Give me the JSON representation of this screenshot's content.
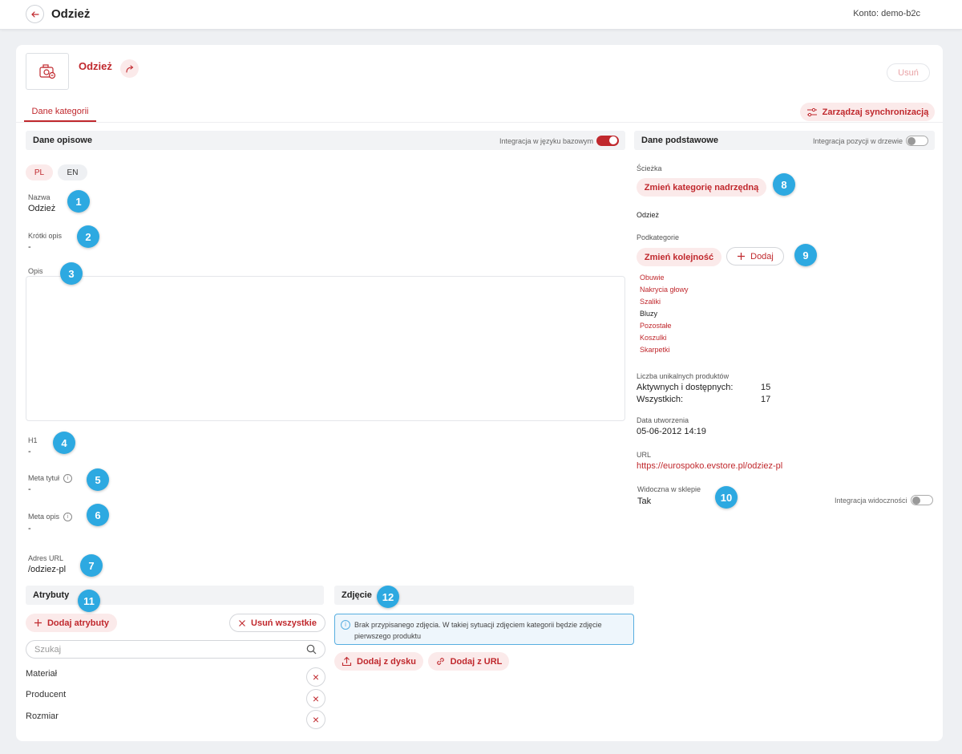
{
  "topbar": {
    "title": "Odzież",
    "account": "Konto: demo-b2c"
  },
  "header": {
    "title": "Odzież",
    "delete_label": "Usuń"
  },
  "tabs": [
    {
      "label": "Dane kategorii"
    }
  ],
  "sync_button": {
    "label": "Zarządzaj synchronizacją"
  },
  "descriptive": {
    "title": "Dane opisowe",
    "integration_label": "Integracja w języku bazowym",
    "languages": [
      "PL",
      "EN"
    ],
    "fields": {
      "name": {
        "label": "Nazwa",
        "value": "Odzież"
      },
      "short_desc": {
        "label": "Krótki opis",
        "value": "-"
      },
      "desc": {
        "label": "Opis"
      },
      "h1": {
        "label": "H1",
        "value": "-"
      },
      "meta_title": {
        "label": "Meta tytuł",
        "value": "-"
      },
      "meta_desc": {
        "label": "Meta opis",
        "value": "-"
      },
      "url": {
        "label": "Adres URL",
        "value": "/odziez-pl"
      }
    }
  },
  "basic": {
    "title": "Dane podstawowe",
    "integration_label": "Integracja pozycji w drzewie",
    "path_label": "Ścieżka",
    "change_parent_label": "Zmień kategorię nadrzędną",
    "path_value": "Odzież",
    "subcategories_label": "Podkategorie",
    "change_order_label": "Zmień kolejność",
    "add_label": "Dodaj",
    "subcategories": [
      "Obuwie",
      "Nakrycia głowy",
      "Szaliki",
      "Bluzy",
      "Pozostałe",
      "Koszulki",
      "Skarpetki"
    ],
    "unique_label": "Liczba unikalnych produktów",
    "active_label": "Aktywnych i dostępnych:",
    "active_value": "15",
    "all_label": "Wszystkich:",
    "all_value": "17",
    "created_label": "Data utworzenia",
    "created_value": "05-06-2012 14:19",
    "url_label": "URL",
    "url_value": "https://eurospoko.evstore.pl/odziez-pl",
    "visible_label": "Widoczna w sklepie",
    "visible_value": "Tak",
    "visibility_integration_label": "Integracja widoczności"
  },
  "attributes": {
    "title": "Atrybuty",
    "add_label": "Dodaj atrybuty",
    "remove_all_label": "Usuń wszystkie",
    "search_placeholder": "Szukaj",
    "items": [
      "Materiał",
      "Producent",
      "Rozmiar"
    ]
  },
  "photo": {
    "title": "Zdjęcie",
    "info_text": "Brak przypisanego zdjęcia. W takiej sytuacji zdjęciem kategorii będzie zdjęcie pierwszego produktu",
    "from_disk_label": "Dodaj z dysku",
    "from_url_label": "Dodaj z URL"
  },
  "badges": [
    "1",
    "2",
    "3",
    "4",
    "5",
    "6",
    "7",
    "8",
    "9",
    "10",
    "11",
    "12"
  ],
  "colors": {
    "accent": "#c0282d",
    "accent_light": "#fbeaea",
    "badge": "#2da9e1"
  }
}
